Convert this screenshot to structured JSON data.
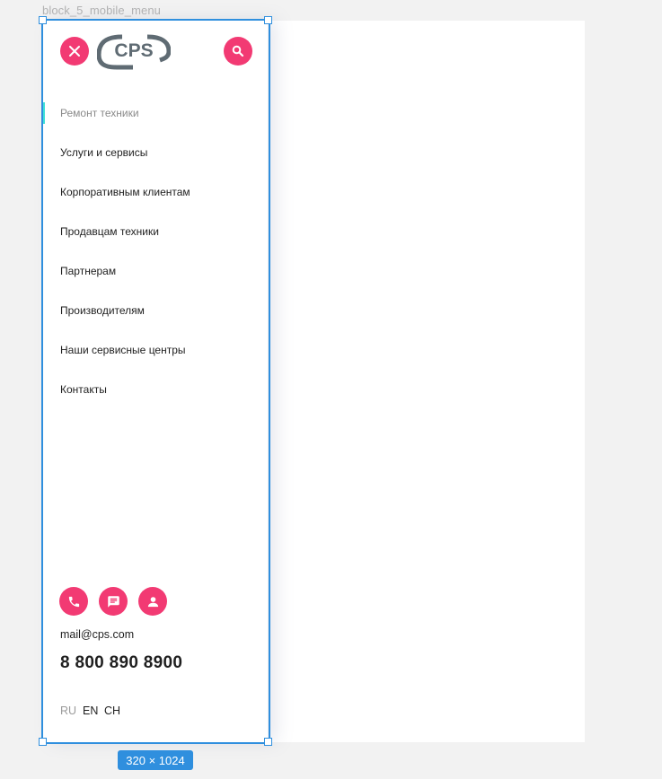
{
  "frame_label": "block_5_mobile_menu",
  "logo_text": "CPS",
  "nav_items": [
    {
      "label": "Ремонт техники",
      "active": true
    },
    {
      "label": "Услуги и сервисы"
    },
    {
      "label": "Корпоративным клиентам"
    },
    {
      "label": "Продавцам техники"
    },
    {
      "label": "Партнерам"
    },
    {
      "label": "Производителям"
    },
    {
      "label": "Наши сервисные центры"
    },
    {
      "label": "Контакты"
    }
  ],
  "contact": {
    "email": "mail@cps.com",
    "phone": "8 800 890 8900"
  },
  "languages": [
    "RU",
    "EN",
    "CH"
  ],
  "size_badge": "320 × 1024",
  "colors": {
    "accent": "#f23a73",
    "active_marker": "#3ee0d7",
    "selection": "#2f8fde",
    "logo": "#5f6b73"
  },
  "icons": {
    "close": "close-icon",
    "search": "search-icon",
    "phone": "phone-icon",
    "chat": "chat-icon",
    "user": "user-icon"
  }
}
